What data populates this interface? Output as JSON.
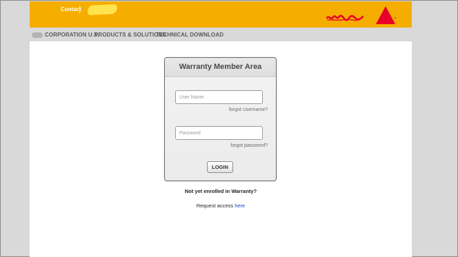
{
  "header": {
    "contact_label": "Contact",
    "background_color": "#f5ad00",
    "brand_color": "#e8002a"
  },
  "nav": {
    "items": [
      {
        "label": "CORPORATION U.S."
      },
      {
        "label": "PRODUCTS & SOLUTIONS"
      },
      {
        "label": "TECHNICAL DOWNLOAD"
      }
    ]
  },
  "login": {
    "title": "Warranty Member Area",
    "username_placeholder": "User Name",
    "password_placeholder": "Password",
    "forgot_username": "forgot Username?",
    "forgot_password": "forgot password?",
    "button_label": "LOGIN"
  },
  "enroll": {
    "question": "Not yet enrolled in Warranty?",
    "request_prefix": "Request access",
    "request_link": "here"
  }
}
